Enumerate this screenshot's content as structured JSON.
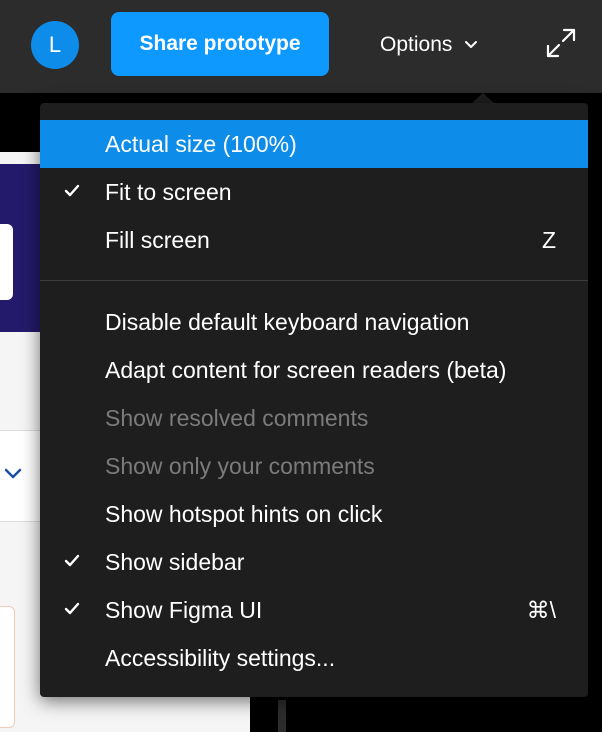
{
  "toolbar": {
    "avatar_initial": "L",
    "share_label": "Share prototype",
    "options_label": "Options",
    "icons": {
      "options_chevron": "chevron-down-icon",
      "expand": "expand-icon"
    }
  },
  "menu": {
    "items": [
      {
        "label": "Actual size (100%)",
        "checked": false,
        "shortcut": "",
        "state": "highlighted"
      },
      {
        "label": "Fit to screen",
        "checked": true,
        "shortcut": "",
        "state": "normal"
      },
      {
        "label": "Fill screen",
        "checked": false,
        "shortcut": "Z",
        "state": "normal"
      },
      {
        "label": "Disable default keyboard navigation",
        "checked": false,
        "shortcut": "",
        "state": "normal"
      },
      {
        "label": "Adapt content for screen readers (beta)",
        "checked": false,
        "shortcut": "",
        "state": "normal"
      },
      {
        "label": "Show resolved comments",
        "checked": false,
        "shortcut": "",
        "state": "disabled"
      },
      {
        "label": "Show only your comments",
        "checked": false,
        "shortcut": "",
        "state": "disabled"
      },
      {
        "label": "Show hotspot hints on click",
        "checked": false,
        "shortcut": "",
        "state": "normal"
      },
      {
        "label": "Show sidebar",
        "checked": true,
        "shortcut": "",
        "state": "normal"
      },
      {
        "label": "Show Figma UI",
        "checked": true,
        "shortcut": "⌘\\",
        "state": "normal"
      },
      {
        "label": "Accessibility settings...",
        "checked": false,
        "shortcut": "",
        "state": "normal"
      }
    ]
  },
  "colors": {
    "toolbar_bg": "#2c2c2c",
    "accent": "#0d99ff",
    "menu_bg": "#1e1e1e",
    "highlight": "#0d8ce9",
    "disabled_text": "#7b7b7b"
  }
}
